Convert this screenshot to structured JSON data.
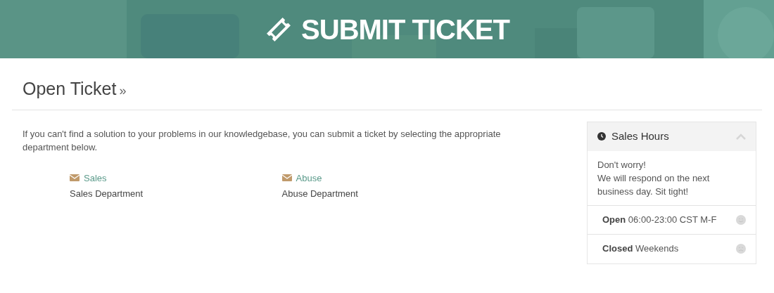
{
  "banner": {
    "title": "SUBMIT TICKET"
  },
  "heading": {
    "title": "Open Ticket",
    "suffix": "»"
  },
  "intro": "If you can't find a solution to your problems in our knowledgebase, you can submit a ticket by selecting the appropriate department below.",
  "departments": [
    {
      "name": "Sales",
      "description": "Sales Department"
    },
    {
      "name": "Abuse",
      "description": "Abuse Department"
    }
  ],
  "panel": {
    "title": "Sales Hours",
    "expanded": true,
    "message": [
      "Don't worry!",
      "We will respond on the next business day. Sit tight!"
    ],
    "items": [
      {
        "text": "**Open** 06:00-23:00 CST M-F",
        "kind": "happy"
      },
      {
        "text": "**Closed** Weekends",
        "kind": "sad"
      }
    ]
  }
}
